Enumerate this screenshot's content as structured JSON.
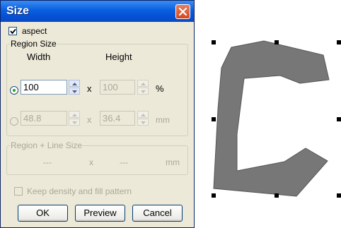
{
  "dialog": {
    "title": "Size",
    "aspect_label": "aspect",
    "aspect_checked": true,
    "region_size": {
      "legend": "Region Size",
      "width_header": "Width",
      "height_header": "Height",
      "percent_row": {
        "selected": true,
        "width_value": "100",
        "separator": "x",
        "height_value": "100",
        "unit": "%"
      },
      "mm_row": {
        "selected": false,
        "width_value": "48.8",
        "separator": "x",
        "height_value": "36.4",
        "unit": "mm"
      }
    },
    "region_line_size": {
      "legend": "Region + Line Size",
      "width_value": "---",
      "separator": "x",
      "height_value": "---",
      "unit": "mm"
    },
    "keep_density_label": "Keep density and fill pattern",
    "keep_density_checked": false,
    "buttons": {
      "ok": "OK",
      "preview": "Preview",
      "cancel": "Cancel"
    }
  },
  "canvas": {
    "shape_glyph": "C",
    "shape_fill": "#777777",
    "handle_color": "#000000"
  }
}
